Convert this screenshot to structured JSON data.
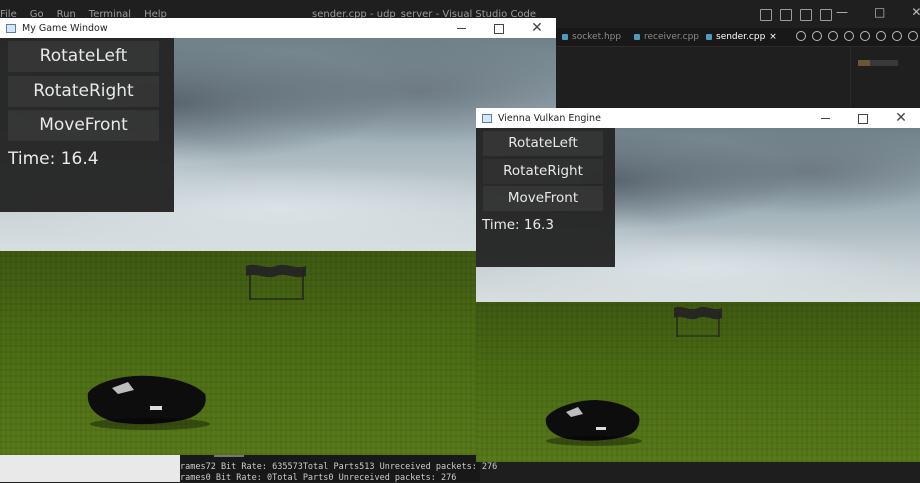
{
  "vscode": {
    "menu": [
      "File",
      "Go",
      "Run",
      "Terminal",
      "Help"
    ],
    "title": "sender.cpp - udp_server - Visual Studio Code",
    "tabs": [
      {
        "label": "socket.hpp",
        "active": false
      },
      {
        "label": "receiver.cpp",
        "active": false
      },
      {
        "label": "sender.cpp",
        "active": true
      },
      {
        "label": "×",
        "active": false
      }
    ],
    "terminal_lines": [
      "rames72 Bit Rate: 635573Total Parts513 Unreceived packets: 276",
      "rames0 Bit Rate: 0Total Parts0 Unreceived packets: 276"
    ]
  },
  "game_window": {
    "title": "My Game Window",
    "controls": {
      "minimize": "",
      "maximize": "",
      "close": "✕"
    },
    "hud": {
      "buttons": [
        "RotateLeft",
        "RotateRight",
        "MoveFront"
      ],
      "time_label": "Time: 16.4"
    }
  },
  "vienna_window": {
    "title": "Vienna Vulkan Engine",
    "controls": {
      "minimize": "",
      "maximize": "",
      "close": "✕"
    },
    "hud": {
      "buttons": [
        "RotateLeft",
        "RotateRight",
        "MoveFront"
      ],
      "time_label": "Time: 16.3"
    }
  },
  "colors": {
    "hud_bg": "#262626",
    "hud_button": "#333333",
    "grass": "#4b6b14",
    "vscode_bg": "#1e1e1e"
  }
}
